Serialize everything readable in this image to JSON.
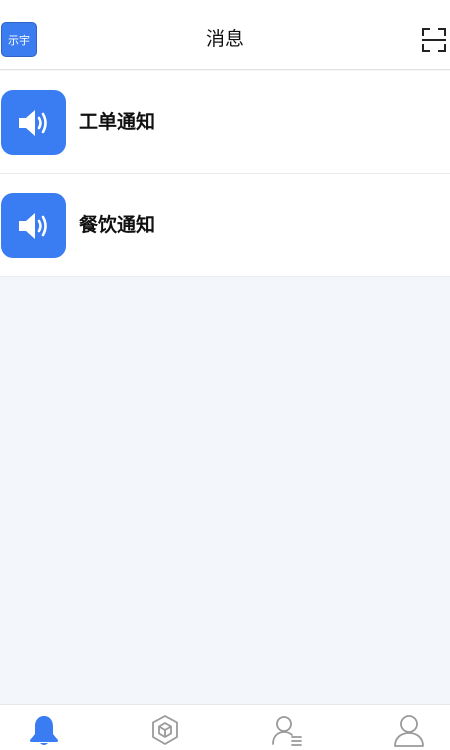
{
  "header": {
    "badge_text": "示宇",
    "title": "消息",
    "scan_icon": "scan-icon"
  },
  "notifications": [
    {
      "label": "工单通知",
      "icon": "speaker-icon"
    },
    {
      "label": "餐饮通知",
      "icon": "speaker-icon"
    }
  ],
  "bottom_nav": [
    {
      "icon": "bell-icon",
      "active": true
    },
    {
      "icon": "box-icon",
      "active": false
    },
    {
      "icon": "contacts-icon",
      "active": false
    },
    {
      "icon": "user-icon",
      "active": false
    }
  ],
  "colors": {
    "accent": "#3a7cf2",
    "background": "#f3f6fa",
    "inactive_icon": "#9a9a9a"
  }
}
